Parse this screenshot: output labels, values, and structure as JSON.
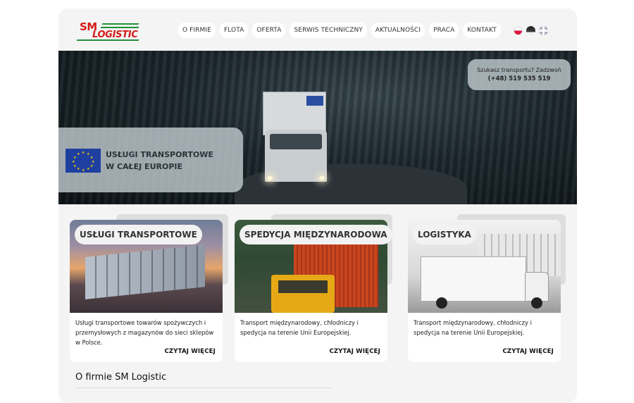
{
  "logo": {
    "top": "SM",
    "bottom": "LOGISTIC"
  },
  "nav": [
    "O FIRMIE",
    "FLOTA",
    "OFERTA",
    "SERWIS TECHNICZNY",
    "AKTUALNOŚCI",
    "PRACA",
    "KONTAKT"
  ],
  "languages": [
    "pl-flag-icon",
    "de-flag-icon",
    "gb-flag-icon"
  ],
  "hero": {
    "headline_line1": "USŁUGI TRANSPORTOWE",
    "headline_line2": "W CAŁEJ EUROPIE",
    "call_text": "Szukasz transportu? Zadzwoń",
    "call_phone": "(+48) 519 535 519"
  },
  "cards": [
    {
      "title": "USŁUGI TRANSPORTOWE",
      "text": "Usługi transportowe towarów spożywczych i przemysłowych z magazynów do sieci sklepów w Polsce.",
      "more": "CZYTAJ WIĘCEJ"
    },
    {
      "title": "SPEDYCJA MIĘDZYNARODOWA",
      "text": "Transport międzynarodowy, chłodniczy i spedycja na terenie Unii Europejskiej.",
      "more": "CZYTAJ WIĘCEJ"
    },
    {
      "title": "LOGISTYKA",
      "text": "Transport międzynarodowy, chłodniczy i spedycja na terenie Unii Europejskiej.",
      "more": "CZYTAJ WIĘCEJ"
    }
  ],
  "about": {
    "title": "O firmie SM Logistic"
  },
  "colors": {
    "brand_red": "#d41a1a",
    "brand_green": "#1f8f3a",
    "eu_blue": "#1f3fa0"
  }
}
